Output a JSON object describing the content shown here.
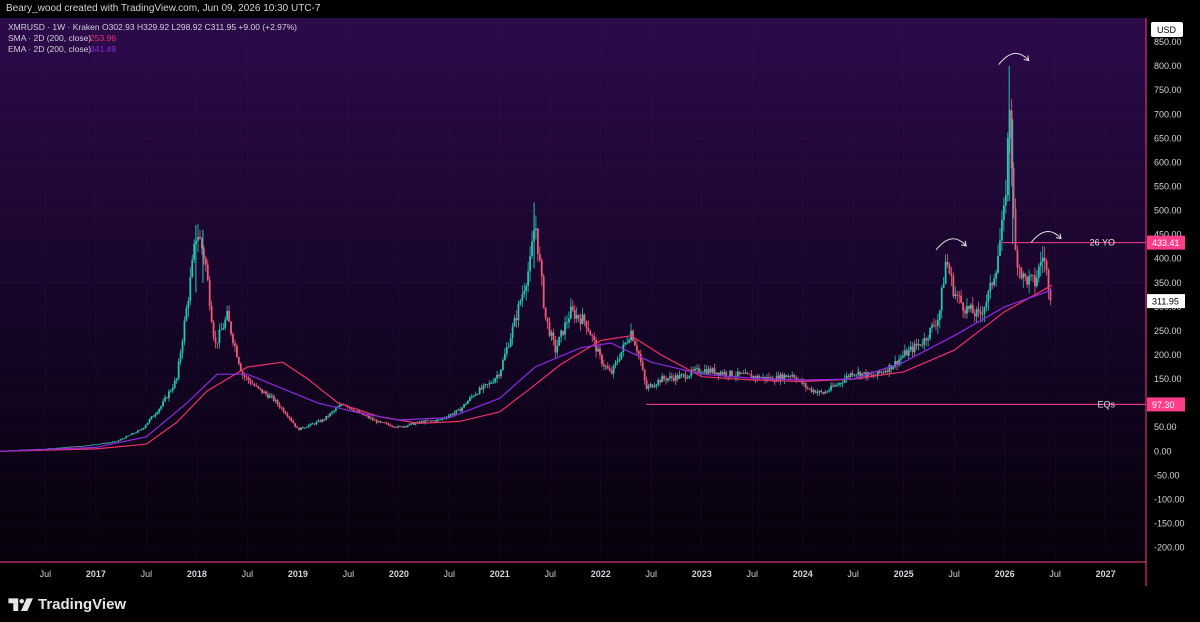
{
  "header": {
    "attribution": "Beary_wood created with TradingView.com, Jun 09, 2026 10:30 UTC-7"
  },
  "legend": {
    "symbol_line": "XMRUSD · 1W · Kraken  O302.93  H329.92  L298.92  C311.95  +9.00 (+2.97%)",
    "sma_label": "SMA · 2D (200, close)",
    "sma_value": "253.96",
    "ema_label": "EMA · 2D (200, close)",
    "ema_value": "341.49"
  },
  "colors": {
    "bg_top": "#2b0a4a",
    "bg_bottom": "#05010a",
    "up": "#26c6b0",
    "down": "#ef5a7a",
    "sma": "#f0306a",
    "ema": "#8a2be2",
    "level": "#ff3d8b",
    "grid": "#3a1a55"
  },
  "chart_data": {
    "type": "candlestick",
    "currency": "USD",
    "ylim": [
      -230,
      900
    ],
    "y_ticks": [
      -200,
      -150,
      -100,
      -50,
      0,
      50,
      100,
      150,
      200,
      250,
      300,
      350,
      400,
      450,
      500,
      550,
      600,
      650,
      700,
      750,
      800,
      850
    ],
    "y_tick_labels": [
      "-200.00",
      "-150.00",
      "-100.00",
      "-50.00",
      "0.00",
      "50.00",
      "100.00",
      "150.00",
      "200.00",
      "250.00",
      "300.00",
      "350.00",
      "400.00",
      "450.00",
      "500.00",
      "550.00",
      "600.00",
      "650.00",
      "700.00",
      "750.00",
      "800.00",
      "850.00"
    ],
    "xlim": [
      2016.05,
      2027.4
    ],
    "x_ticks": [
      {
        "t": 2016.5,
        "label": "Jul"
      },
      {
        "t": 2017.0,
        "label": "2017"
      },
      {
        "t": 2017.5,
        "label": "Jul"
      },
      {
        "t": 2018.0,
        "label": "2018"
      },
      {
        "t": 2018.5,
        "label": "Jul"
      },
      {
        "t": 2019.0,
        "label": "2019"
      },
      {
        "t": 2019.5,
        "label": "Jul"
      },
      {
        "t": 2020.0,
        "label": "2020"
      },
      {
        "t": 2020.5,
        "label": "Jul"
      },
      {
        "t": 2021.0,
        "label": "2021"
      },
      {
        "t": 2021.5,
        "label": "Jul"
      },
      {
        "t": 2022.0,
        "label": "2022"
      },
      {
        "t": 2022.5,
        "label": "Jul"
      },
      {
        "t": 2023.0,
        "label": "2023"
      },
      {
        "t": 2023.5,
        "label": "Jul"
      },
      {
        "t": 2024.0,
        "label": "2024"
      },
      {
        "t": 2024.5,
        "label": "Jul"
      },
      {
        "t": 2025.0,
        "label": "2025"
      },
      {
        "t": 2025.5,
        "label": "Jul"
      },
      {
        "t": 2026.0,
        "label": "2026"
      },
      {
        "t": 2026.5,
        "label": "Jul"
      },
      {
        "t": 2027.0,
        "label": "2027"
      }
    ],
    "price_path": [
      [
        2016.05,
        1
      ],
      [
        2016.5,
        5
      ],
      [
        2016.9,
        12
      ],
      [
        2017.2,
        20
      ],
      [
        2017.45,
        45
      ],
      [
        2017.65,
        95
      ],
      [
        2017.8,
        150
      ],
      [
        2017.92,
        330
      ],
      [
        2018.0,
        460
      ],
      [
        2018.08,
        400
      ],
      [
        2018.18,
        220
      ],
      [
        2018.3,
        280
      ],
      [
        2018.45,
        160
      ],
      [
        2018.6,
        130
      ],
      [
        2018.75,
        110
      ],
      [
        2018.9,
        75
      ],
      [
        2019.0,
        45
      ],
      [
        2019.25,
        65
      ],
      [
        2019.45,
        100
      ],
      [
        2019.6,
        80
      ],
      [
        2019.8,
        60
      ],
      [
        2020.0,
        50
      ],
      [
        2020.2,
        60
      ],
      [
        2020.4,
        65
      ],
      [
        2020.6,
        85
      ],
      [
        2020.75,
        120
      ],
      [
        2020.9,
        140
      ],
      [
        2021.0,
        165
      ],
      [
        2021.15,
        270
      ],
      [
        2021.3,
        390
      ],
      [
        2021.35,
        480
      ],
      [
        2021.45,
        280
      ],
      [
        2021.55,
        210
      ],
      [
        2021.7,
        290
      ],
      [
        2021.85,
        270
      ],
      [
        2022.0,
        190
      ],
      [
        2022.1,
        160
      ],
      [
        2022.3,
        250
      ],
      [
        2022.38,
        200
      ],
      [
        2022.45,
        130
      ],
      [
        2022.6,
        150
      ],
      [
        2022.8,
        155
      ],
      [
        2023.0,
        170
      ],
      [
        2023.3,
        160
      ],
      [
        2023.5,
        155
      ],
      [
        2023.7,
        150
      ],
      [
        2023.9,
        160
      ],
      [
        2024.05,
        130
      ],
      [
        2024.2,
        120
      ],
      [
        2024.35,
        140
      ],
      [
        2024.5,
        165
      ],
      [
        2024.7,
        155
      ],
      [
        2024.9,
        180
      ],
      [
        2025.0,
        200
      ],
      [
        2025.2,
        230
      ],
      [
        2025.35,
        280
      ],
      [
        2025.42,
        400
      ],
      [
        2025.5,
        330
      ],
      [
        2025.6,
        300
      ],
      [
        2025.75,
        280
      ],
      [
        2025.85,
        330
      ],
      [
        2025.92,
        390
      ],
      [
        2026.0,
        500
      ],
      [
        2026.05,
        720
      ],
      [
        2026.1,
        420
      ],
      [
        2026.18,
        360
      ],
      [
        2026.3,
        350
      ],
      [
        2026.38,
        410
      ],
      [
        2026.45,
        330
      ],
      [
        2026.47,
        312
      ]
    ],
    "spikes": [
      {
        "t": 2017.99,
        "low": 330,
        "high": 470
      },
      {
        "t": 2018.06,
        "low": 350,
        "high": 460
      },
      {
        "t": 2021.34,
        "low": 380,
        "high": 517
      },
      {
        "t": 2026.045,
        "low": 520,
        "high": 800
      },
      {
        "t": 2026.08,
        "low": 430,
        "high": 690
      }
    ],
    "sma_path": [
      [
        2016.05,
        0
      ],
      [
        2017.0,
        5
      ],
      [
        2017.5,
        15
      ],
      [
        2017.8,
        60
      ],
      [
        2018.1,
        125
      ],
      [
        2018.5,
        175
      ],
      [
        2018.85,
        185
      ],
      [
        2019.1,
        150
      ],
      [
        2019.4,
        100
      ],
      [
        2019.8,
        72
      ],
      [
        2020.2,
        58
      ],
      [
        2020.6,
        62
      ],
      [
        2021.0,
        82
      ],
      [
        2021.3,
        130
      ],
      [
        2021.6,
        180
      ],
      [
        2022.0,
        230
      ],
      [
        2022.3,
        240
      ],
      [
        2022.6,
        200
      ],
      [
        2023.0,
        155
      ],
      [
        2023.5,
        148
      ],
      [
        2024.0,
        145
      ],
      [
        2024.5,
        150
      ],
      [
        2025.0,
        165
      ],
      [
        2025.5,
        210
      ],
      [
        2026.0,
        290
      ],
      [
        2026.47,
        345
      ]
    ],
    "ema_path": [
      [
        2016.05,
        0
      ],
      [
        2017.0,
        8
      ],
      [
        2017.5,
        30
      ],
      [
        2017.9,
        100
      ],
      [
        2018.2,
        160
      ],
      [
        2018.5,
        160
      ],
      [
        2018.85,
        130
      ],
      [
        2019.2,
        100
      ],
      [
        2019.6,
        80
      ],
      [
        2020.0,
        65
      ],
      [
        2020.5,
        70
      ],
      [
        2021.0,
        110
      ],
      [
        2021.35,
        175
      ],
      [
        2021.8,
        215
      ],
      [
        2022.1,
        225
      ],
      [
        2022.5,
        185
      ],
      [
        2023.0,
        160
      ],
      [
        2023.5,
        152
      ],
      [
        2024.0,
        148
      ],
      [
        2024.5,
        150
      ],
      [
        2025.0,
        185
      ],
      [
        2025.5,
        240
      ],
      [
        2026.0,
        300
      ],
      [
        2026.47,
        335
      ]
    ],
    "levels": [
      {
        "name": "26 YO",
        "value": 433.41,
        "value_label": "433.41",
        "start": 2025.98
      },
      {
        "name": "EQs",
        "value": 97.3,
        "value_label": "97.30",
        "start": 2022.45
      }
    ],
    "last_price": {
      "value": 311.95,
      "label": "311.95"
    },
    "annotations": [
      {
        "type": "arc",
        "t": 2025.48,
        "v": 435
      },
      {
        "type": "arc",
        "t": 2026.1,
        "v": 820
      },
      {
        "type": "arc",
        "t": 2026.42,
        "v": 450
      }
    ]
  }
}
